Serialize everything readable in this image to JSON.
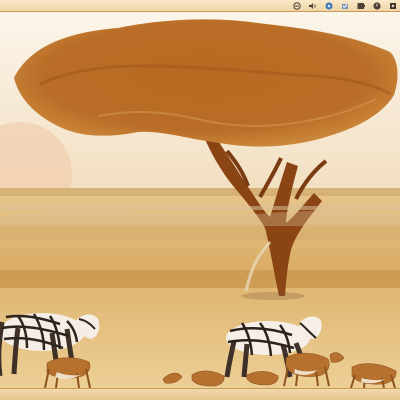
{
  "colors": {
    "panel": "#f2dcb3",
    "sky": "#f8eedb",
    "ground": "#d5a25b",
    "tree": "#8e4b14"
  },
  "panel": {
    "tray_icons": [
      {
        "name": "network-icon"
      },
      {
        "name": "volume-icon"
      },
      {
        "name": "chat-icon"
      },
      {
        "name": "update-icon"
      },
      {
        "name": "battery-icon"
      },
      {
        "name": "power-icon"
      },
      {
        "name": "session-icon"
      }
    ]
  }
}
